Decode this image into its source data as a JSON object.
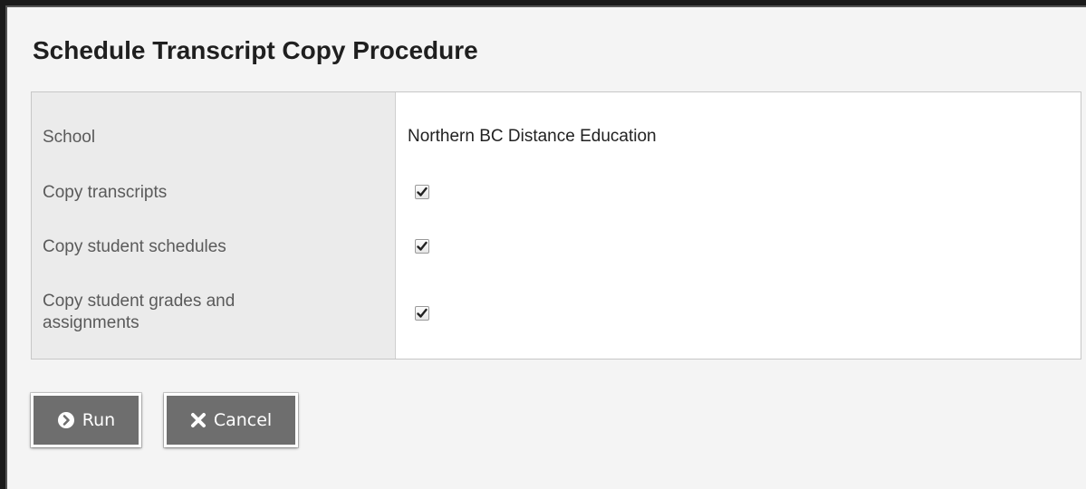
{
  "dialog": {
    "title": "Schedule Transcript Copy Procedure"
  },
  "form": {
    "school_label": "School",
    "school_value": "Northern BC Distance Education",
    "copy_transcripts_label": "Copy transcripts",
    "copy_transcripts_checked": true,
    "copy_schedules_label": "Copy student schedules",
    "copy_schedules_checked": true,
    "copy_grades_label_line1": "Copy student grades and",
    "copy_grades_label_line2": "assignments",
    "copy_grades_checked": true
  },
  "buttons": {
    "run_label": "Run",
    "run_icon": "arrow-circle-right-icon",
    "cancel_label": "Cancel",
    "cancel_icon": "x-icon"
  },
  "colors": {
    "button_bg": "#6e6e6e",
    "label_column_bg": "#ebebeb",
    "page_bg": "#f4f4f4"
  }
}
